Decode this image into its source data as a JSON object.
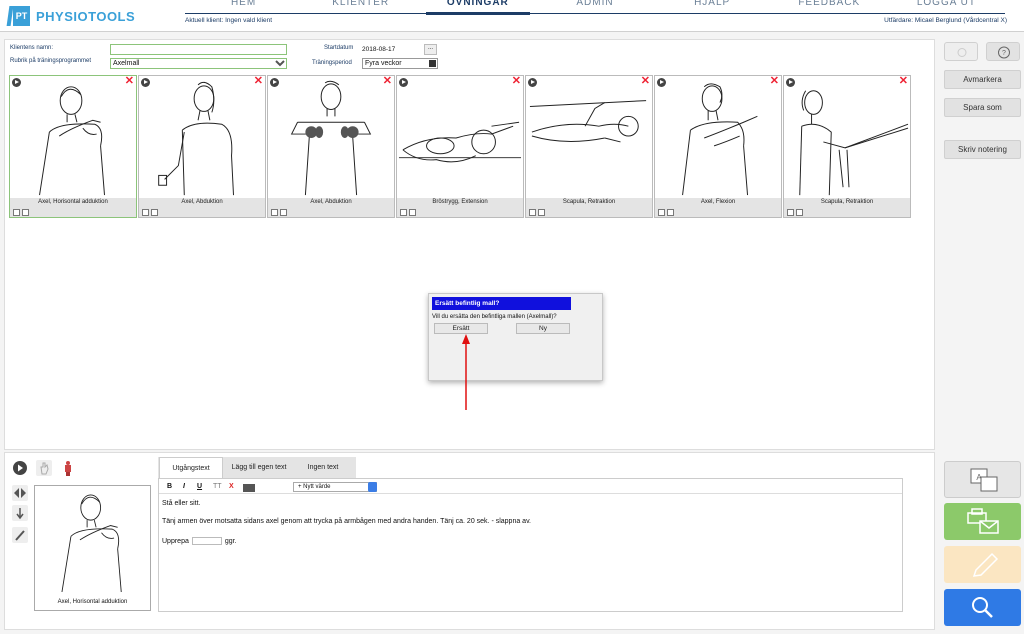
{
  "app": {
    "logo_badge": "PT",
    "name": "PHYSIOTOOLS"
  },
  "nav": {
    "items": [
      "HEM",
      "KLIENTER",
      "ÖVNINGAR",
      "ADMIN",
      "HJÄLP",
      "FEEDBACK",
      "LOGGA UT"
    ],
    "active": "ÖVNINGAR"
  },
  "header": {
    "current_client": "Aktuell klient: Ingen vald klient",
    "therapist": "Utfärdare: Micael Berglund (Vårdcentral X)"
  },
  "form": {
    "client_name_label": "Klientens namn:",
    "client_name_value": "",
    "program_title_label": "Rubrik på träningsprogrammet",
    "program_title_value": "Axelmall",
    "start_date_label": "Startdatum",
    "start_date_value": "2018-08-17",
    "date_button": "...",
    "period_label": "Träningsperiod",
    "period_value": "Fyra veckor"
  },
  "exercises": [
    {
      "label": "Axel, Horisontal adduktion",
      "selected": true
    },
    {
      "label": "Axel, Abduktion",
      "selected": false
    },
    {
      "label": "Axel, Abduktion",
      "selected": false
    },
    {
      "label": "Bröstrygg, Extension",
      "selected": false
    },
    {
      "label": "Scapula, Retraktion",
      "selected": false
    },
    {
      "label": "Axel, Flexion",
      "selected": false
    },
    {
      "label": "Scapula, Retraktion",
      "selected": false
    }
  ],
  "dialog": {
    "title": "Ersätt befintlig mall?",
    "message": "Vill du ersätta den befintliga mallen (Axelmall)?",
    "confirm": "Ersätt",
    "new": "Ny"
  },
  "side_buttons": {
    "deselect": "Avmarkera",
    "save_as": "Spara som",
    "write_note": "Skriv notering",
    "help": "?"
  },
  "editor": {
    "tabs": [
      "Utgångstext",
      "Lägg till egen text",
      "Ingen text"
    ],
    "active_tab": "Utgångstext",
    "toolbar": {
      "bold": "B",
      "italic": "I",
      "underline": "U",
      "font_size": "TT",
      "clear": "X",
      "insert_placeholder": "+ Nytt värde"
    },
    "line1": "Stå eller sitt.",
    "line2": "Tänj armen över motsatta sidans axel genom att trycka på armbågen med andra handen. Tänj ca. 20 sek. - slappna av.",
    "line3_pre": "Upprepa",
    "line3_post": "ggr."
  },
  "preview": {
    "label": "Axel, Horisontal adduktion"
  },
  "colors": {
    "brand": "#3aa0d8",
    "nav": "#1c3c66",
    "dialog_title": "#1010dd",
    "print_button": "#8cc96a",
    "edit_button": "#fbe6c2",
    "search_button": "#2f7ae5",
    "annotation": "#e01010"
  }
}
